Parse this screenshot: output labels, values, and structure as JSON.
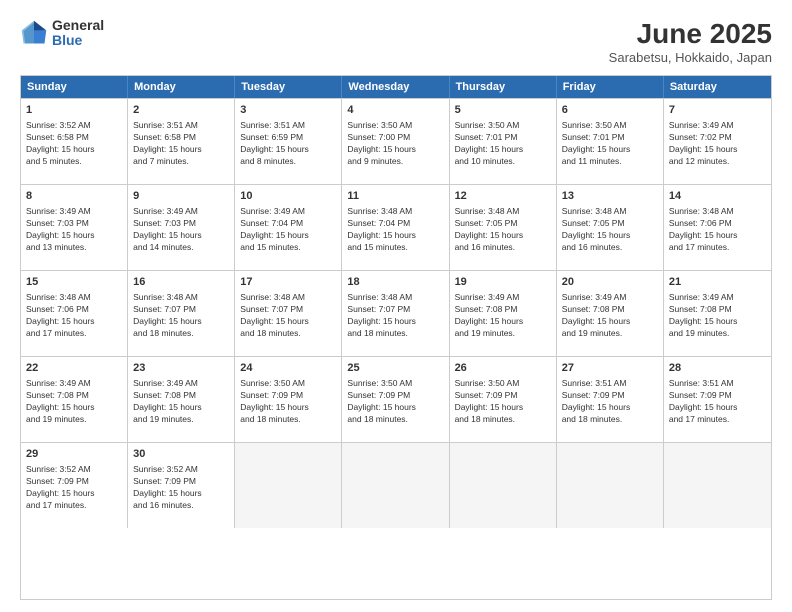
{
  "logo": {
    "general": "General",
    "blue": "Blue"
  },
  "title": "June 2025",
  "location": "Sarabetsu, Hokkaido, Japan",
  "weekdays": [
    "Sunday",
    "Monday",
    "Tuesday",
    "Wednesday",
    "Thursday",
    "Friday",
    "Saturday"
  ],
  "rows": [
    [
      {
        "day": "1",
        "lines": [
          "Sunrise: 3:52 AM",
          "Sunset: 6:58 PM",
          "Daylight: 15 hours",
          "and 5 minutes."
        ]
      },
      {
        "day": "2",
        "lines": [
          "Sunrise: 3:51 AM",
          "Sunset: 6:58 PM",
          "Daylight: 15 hours",
          "and 7 minutes."
        ]
      },
      {
        "day": "3",
        "lines": [
          "Sunrise: 3:51 AM",
          "Sunset: 6:59 PM",
          "Daylight: 15 hours",
          "and 8 minutes."
        ]
      },
      {
        "day": "4",
        "lines": [
          "Sunrise: 3:50 AM",
          "Sunset: 7:00 PM",
          "Daylight: 15 hours",
          "and 9 minutes."
        ]
      },
      {
        "day": "5",
        "lines": [
          "Sunrise: 3:50 AM",
          "Sunset: 7:01 PM",
          "Daylight: 15 hours",
          "and 10 minutes."
        ]
      },
      {
        "day": "6",
        "lines": [
          "Sunrise: 3:50 AM",
          "Sunset: 7:01 PM",
          "Daylight: 15 hours",
          "and 11 minutes."
        ]
      },
      {
        "day": "7",
        "lines": [
          "Sunrise: 3:49 AM",
          "Sunset: 7:02 PM",
          "Daylight: 15 hours",
          "and 12 minutes."
        ]
      }
    ],
    [
      {
        "day": "8",
        "lines": [
          "Sunrise: 3:49 AM",
          "Sunset: 7:03 PM",
          "Daylight: 15 hours",
          "and 13 minutes."
        ]
      },
      {
        "day": "9",
        "lines": [
          "Sunrise: 3:49 AM",
          "Sunset: 7:03 PM",
          "Daylight: 15 hours",
          "and 14 minutes."
        ]
      },
      {
        "day": "10",
        "lines": [
          "Sunrise: 3:49 AM",
          "Sunset: 7:04 PM",
          "Daylight: 15 hours",
          "and 15 minutes."
        ]
      },
      {
        "day": "11",
        "lines": [
          "Sunrise: 3:48 AM",
          "Sunset: 7:04 PM",
          "Daylight: 15 hours",
          "and 15 minutes."
        ]
      },
      {
        "day": "12",
        "lines": [
          "Sunrise: 3:48 AM",
          "Sunset: 7:05 PM",
          "Daylight: 15 hours",
          "and 16 minutes."
        ]
      },
      {
        "day": "13",
        "lines": [
          "Sunrise: 3:48 AM",
          "Sunset: 7:05 PM",
          "Daylight: 15 hours",
          "and 16 minutes."
        ]
      },
      {
        "day": "14",
        "lines": [
          "Sunrise: 3:48 AM",
          "Sunset: 7:06 PM",
          "Daylight: 15 hours",
          "and 17 minutes."
        ]
      }
    ],
    [
      {
        "day": "15",
        "lines": [
          "Sunrise: 3:48 AM",
          "Sunset: 7:06 PM",
          "Daylight: 15 hours",
          "and 17 minutes."
        ]
      },
      {
        "day": "16",
        "lines": [
          "Sunrise: 3:48 AM",
          "Sunset: 7:07 PM",
          "Daylight: 15 hours",
          "and 18 minutes."
        ]
      },
      {
        "day": "17",
        "lines": [
          "Sunrise: 3:48 AM",
          "Sunset: 7:07 PM",
          "Daylight: 15 hours",
          "and 18 minutes."
        ]
      },
      {
        "day": "18",
        "lines": [
          "Sunrise: 3:48 AM",
          "Sunset: 7:07 PM",
          "Daylight: 15 hours",
          "and 18 minutes."
        ]
      },
      {
        "day": "19",
        "lines": [
          "Sunrise: 3:49 AM",
          "Sunset: 7:08 PM",
          "Daylight: 15 hours",
          "and 19 minutes."
        ]
      },
      {
        "day": "20",
        "lines": [
          "Sunrise: 3:49 AM",
          "Sunset: 7:08 PM",
          "Daylight: 15 hours",
          "and 19 minutes."
        ]
      },
      {
        "day": "21",
        "lines": [
          "Sunrise: 3:49 AM",
          "Sunset: 7:08 PM",
          "Daylight: 15 hours",
          "and 19 minutes."
        ]
      }
    ],
    [
      {
        "day": "22",
        "lines": [
          "Sunrise: 3:49 AM",
          "Sunset: 7:08 PM",
          "Daylight: 15 hours",
          "and 19 minutes."
        ]
      },
      {
        "day": "23",
        "lines": [
          "Sunrise: 3:49 AM",
          "Sunset: 7:08 PM",
          "Daylight: 15 hours",
          "and 19 minutes."
        ]
      },
      {
        "day": "24",
        "lines": [
          "Sunrise: 3:50 AM",
          "Sunset: 7:09 PM",
          "Daylight: 15 hours",
          "and 18 minutes."
        ]
      },
      {
        "day": "25",
        "lines": [
          "Sunrise: 3:50 AM",
          "Sunset: 7:09 PM",
          "Daylight: 15 hours",
          "and 18 minutes."
        ]
      },
      {
        "day": "26",
        "lines": [
          "Sunrise: 3:50 AM",
          "Sunset: 7:09 PM",
          "Daylight: 15 hours",
          "and 18 minutes."
        ]
      },
      {
        "day": "27",
        "lines": [
          "Sunrise: 3:51 AM",
          "Sunset: 7:09 PM",
          "Daylight: 15 hours",
          "and 18 minutes."
        ]
      },
      {
        "day": "28",
        "lines": [
          "Sunrise: 3:51 AM",
          "Sunset: 7:09 PM",
          "Daylight: 15 hours",
          "and 17 minutes."
        ]
      }
    ],
    [
      {
        "day": "29",
        "lines": [
          "Sunrise: 3:52 AM",
          "Sunset: 7:09 PM",
          "Daylight: 15 hours",
          "and 17 minutes."
        ]
      },
      {
        "day": "30",
        "lines": [
          "Sunrise: 3:52 AM",
          "Sunset: 7:09 PM",
          "Daylight: 15 hours",
          "and 16 minutes."
        ]
      },
      {
        "day": "",
        "lines": []
      },
      {
        "day": "",
        "lines": []
      },
      {
        "day": "",
        "lines": []
      },
      {
        "day": "",
        "lines": []
      },
      {
        "day": "",
        "lines": []
      }
    ]
  ]
}
